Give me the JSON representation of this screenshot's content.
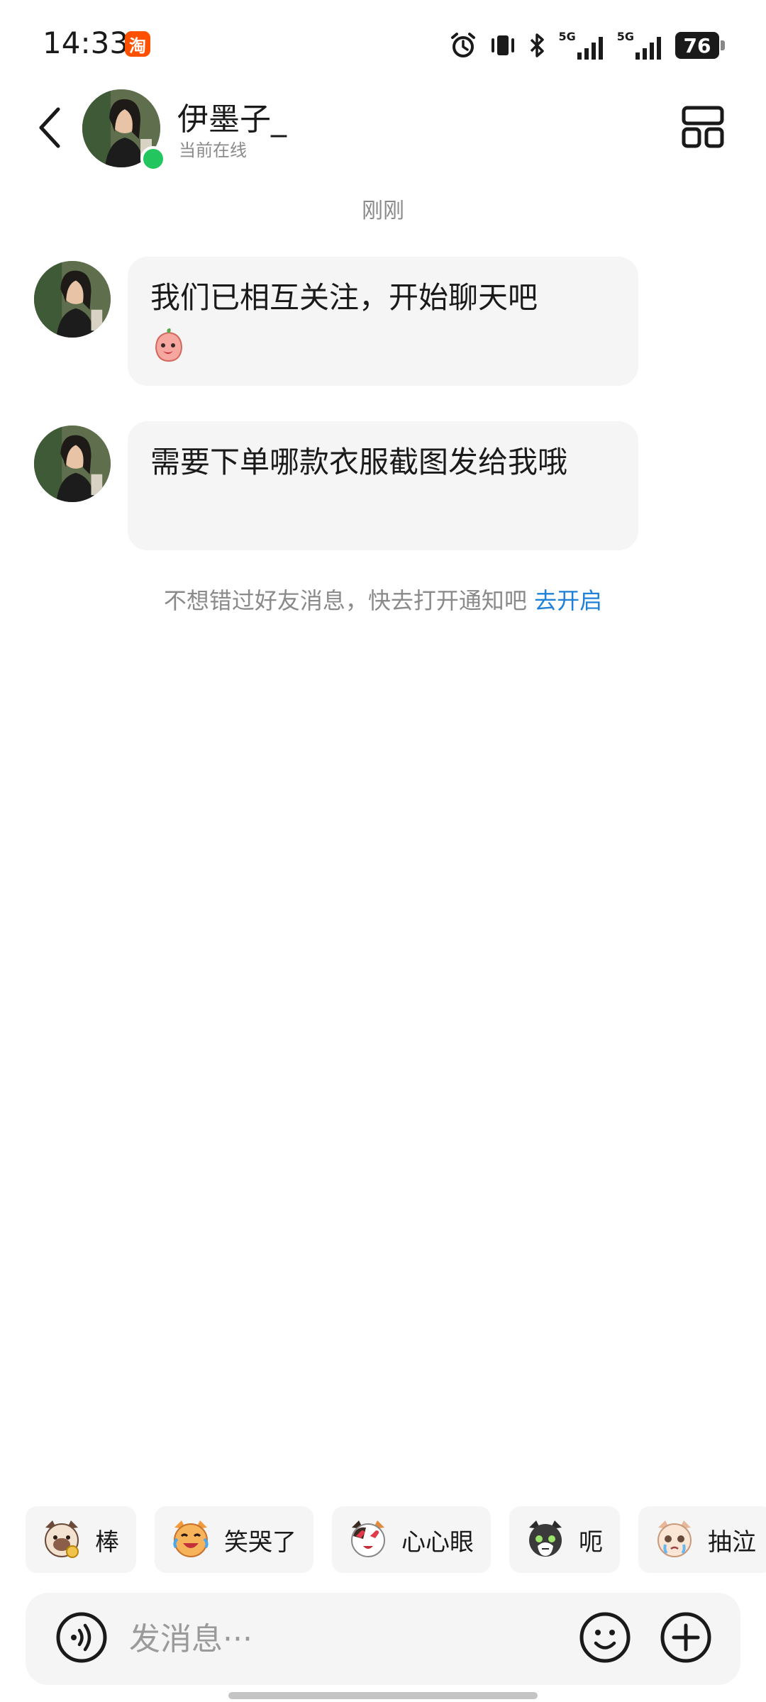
{
  "status_bar": {
    "time": "14:33",
    "app_icon": "taobao-app-icon",
    "app_icon_glyph": "淘",
    "network1": "5G",
    "network2": "5G",
    "battery": "76"
  },
  "header": {
    "contact_name": "伊墨子_",
    "contact_status": "当前在线",
    "online_color": "#22c55e"
  },
  "chat": {
    "time_divider": "刚刚",
    "messages": [
      {
        "sender": "伊墨子_",
        "text": "我们已相互关注，开始聊天吧",
        "sticker": "peach-sticker"
      },
      {
        "sender": "伊墨子_",
        "text": "需要下单哪款衣服截图发给我哦"
      }
    ],
    "notice_text": "不想错过好友消息，快去打开通知吧",
    "notice_link": "去开启",
    "link_color": "#1f80d8"
  },
  "quick_emojis": [
    {
      "label": "棒",
      "icon": "siamese-cat-thumbs-up-icon"
    },
    {
      "label": "笑哭了",
      "icon": "orange-cat-laugh-cry-icon"
    },
    {
      "label": "心心眼",
      "icon": "calico-cat-heart-eyes-icon"
    },
    {
      "label": "呃",
      "icon": "tuxedo-cat-awkward-icon"
    },
    {
      "label": "抽泣",
      "icon": "cat-sobbing-icon"
    }
  ],
  "input": {
    "placeholder": "发消息···"
  }
}
